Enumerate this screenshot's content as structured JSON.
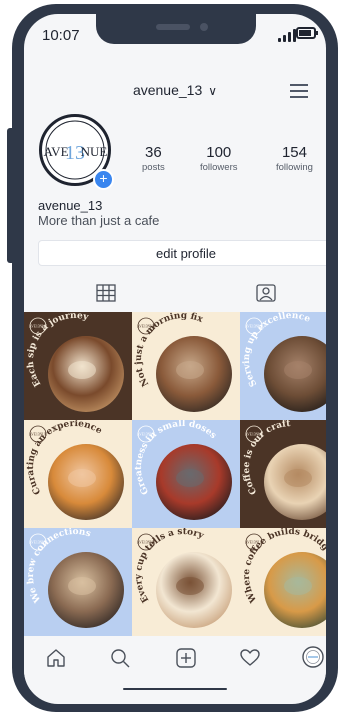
{
  "status_bar": {
    "time": "10:07"
  },
  "header": {
    "username": "avenue_13",
    "chevron": "∨"
  },
  "profile": {
    "avatar_logo": {
      "left_text": "AVE",
      "center_text": "13",
      "right_text": "NUE",
      "accent": "#6fa6dc"
    },
    "stats": [
      {
        "value": "36",
        "label": "posts"
      },
      {
        "value": "100",
        "label": "followers"
      },
      {
        "value": "154",
        "label": "following"
      }
    ],
    "name": "avenue_13",
    "bio": "More than just a cafe",
    "edit_button": "edit profile"
  },
  "tabs": [
    {
      "icon": "grid-icon"
    },
    {
      "icon": "tagged-person-icon"
    }
  ],
  "posts": [
    {
      "caption": "Each sip is a journey",
      "bg": "#4b3426",
      "text_color": "#f4e9d8"
    },
    {
      "caption": "Not just a morning fix",
      "bg": "#f8ecd6",
      "text_color": "#4b3426"
    },
    {
      "caption": "Serving up excellence",
      "bg": "#b9cff1",
      "text_color": "#ffffff"
    },
    {
      "caption": "Curating an experience",
      "bg": "#f8ecd6",
      "text_color": "#4b3426"
    },
    {
      "caption": "Greatness in small doses",
      "bg": "#b9cff1",
      "text_color": "#ffffff"
    },
    {
      "caption": "Coffee is our craft",
      "bg": "#4b3426",
      "text_color": "#f4e9d8"
    },
    {
      "caption": "We brew connections",
      "bg": "#b9cff1",
      "text_color": "#ffffff"
    },
    {
      "caption": "Every cup tells a story",
      "bg": "#f8ecd6",
      "text_color": "#4b3426"
    },
    {
      "caption": "Where coffee builds bridges",
      "bg": "#f8ecd6",
      "text_color": "#4b3426"
    }
  ],
  "post_badge": "AVE13NUE",
  "bottom_nav": [
    {
      "icon": "home-icon"
    },
    {
      "icon": "search-icon"
    },
    {
      "icon": "add-post-icon"
    },
    {
      "icon": "heart-icon"
    },
    {
      "icon": "profile-avatar-icon"
    }
  ],
  "colors": {
    "phone_frame": "#2f3848",
    "accent_blue": "#3a86ef",
    "brown": "#4b3426",
    "cream": "#f8ecd6",
    "light_blue": "#b9cff1"
  }
}
